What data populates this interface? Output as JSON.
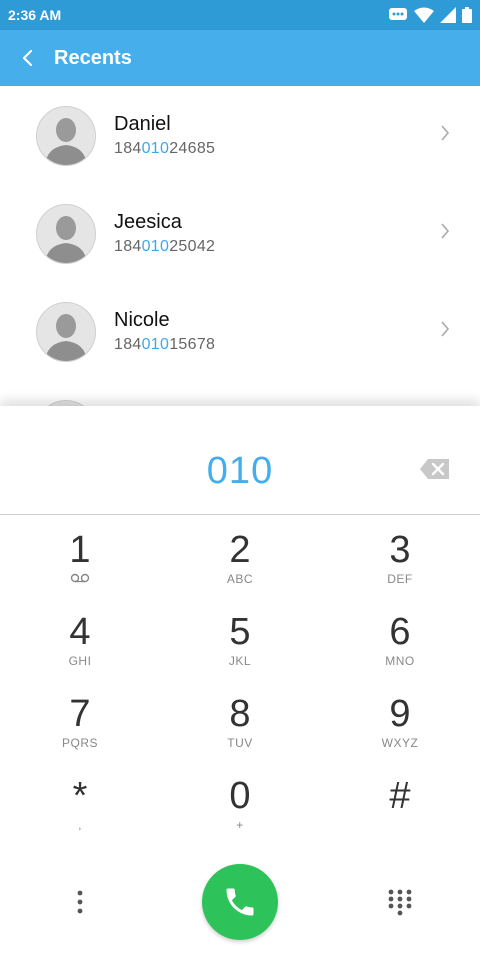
{
  "status": {
    "time": "2:36 AM",
    "icons": [
      "message-icon",
      "wifi-icon",
      "signal-icon",
      "battery-icon"
    ]
  },
  "header": {
    "title": "Recents",
    "back_icon": "back-chevron-icon"
  },
  "contacts": [
    {
      "name": "Daniel",
      "number_pre": "184",
      "number_match": "010",
      "number_post": "24685"
    },
    {
      "name": "Jeesica",
      "number_pre": "184",
      "number_match": "010",
      "number_post": "25042"
    },
    {
      "name": "Nicole",
      "number_pre": "184",
      "number_match": "010",
      "number_post": "15678"
    }
  ],
  "dialer": {
    "entered": "010",
    "keys": [
      {
        "digit": "1",
        "letters": ""
      },
      {
        "digit": "2",
        "letters": "ABC"
      },
      {
        "digit": "3",
        "letters": "DEF"
      },
      {
        "digit": "4",
        "letters": "GHI"
      },
      {
        "digit": "5",
        "letters": "JKL"
      },
      {
        "digit": "6",
        "letters": "MNO"
      },
      {
        "digit": "7",
        "letters": "PQRS"
      },
      {
        "digit": "8",
        "letters": "TUV"
      },
      {
        "digit": "9",
        "letters": "WXYZ"
      },
      {
        "digit": "*",
        "letters": ","
      },
      {
        "digit": "0",
        "letters": "+"
      },
      {
        "digit": "#",
        "letters": ""
      }
    ]
  },
  "colors": {
    "status_bar": "#2f9bd6",
    "app_bar": "#46aeea",
    "highlight": "#3ba8ea",
    "call_button": "#2ec35a"
  }
}
